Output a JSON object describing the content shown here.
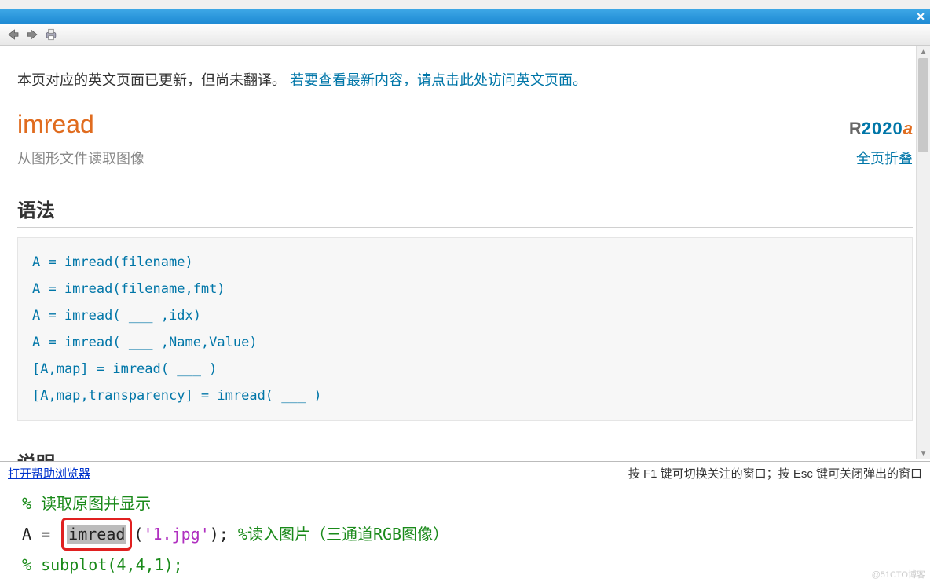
{
  "notice": {
    "prefix": "本页对应的英文页面已更新，但尚未翻译。 ",
    "link": "若要查看最新内容，请点击此处访问英文页面。"
  },
  "fn": {
    "name": "imread",
    "release_r": "R",
    "release_year": "2020",
    "release_suffix": "a",
    "subtitle": "从图形文件读取图像",
    "collapse": "全页折叠"
  },
  "sections": {
    "syntax_title": "语法",
    "syntax_code": "A = imread(filename)\nA = imread(filename,fmt)\nA = imread( ___ ,idx)\nA = imread( ___ ,Name,Value)\n[A,map] = imread( ___ )\n[A,map,transparency] = imread( ___ )",
    "desc_title": "说明"
  },
  "footer": {
    "open_browser": "打开帮助浏览器",
    "hint": "按 F1 键可切换关注的窗口；按 Esc 键可关闭弹出的窗口"
  },
  "editor": {
    "l1_cmt": "% 读取原图并显示",
    "l2_a": "A = ",
    "l2_fn": "imread",
    "l2_paren": "(",
    "l2_str": "'1.jpg'",
    "l2_close": ");",
    "l2_cmt": " %读入图片（三通道RGB图像）",
    "l3": "% subplot(4,4,1);"
  },
  "watermark": "@51CTO博客"
}
